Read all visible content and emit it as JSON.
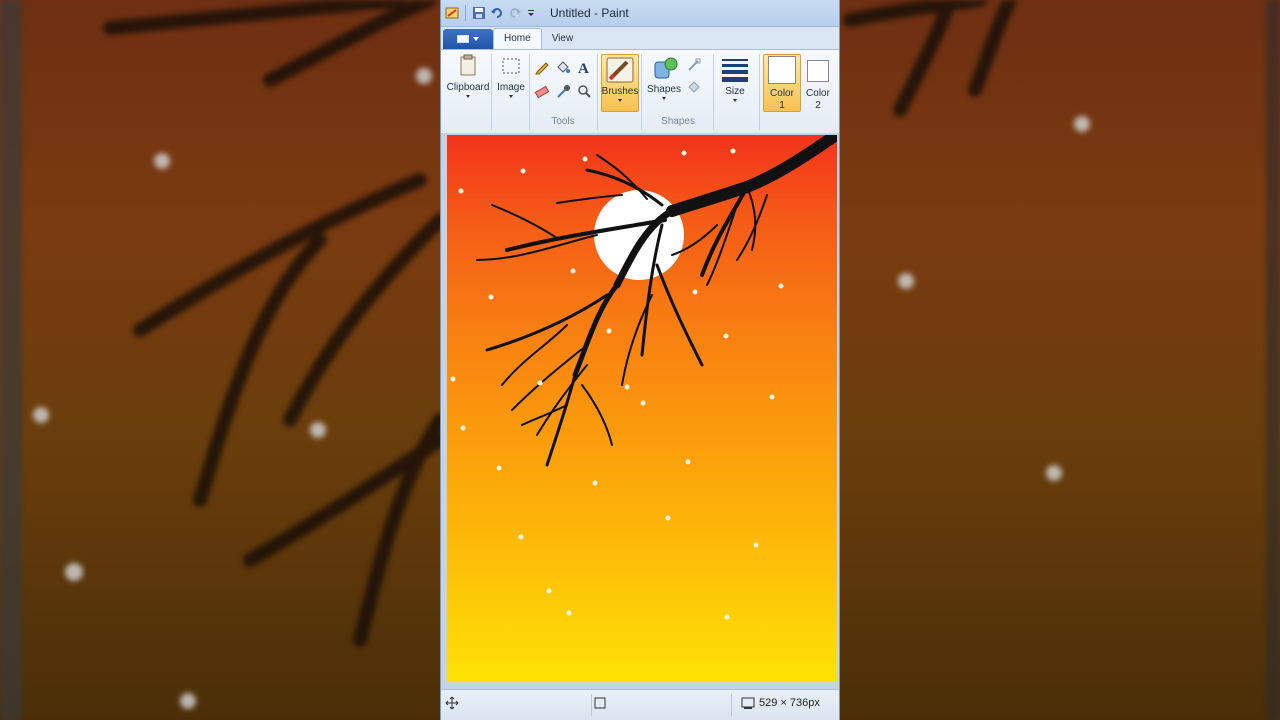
{
  "window": {
    "title": "Untitled - Paint"
  },
  "tabs": [
    "Home",
    "View"
  ],
  "ribbon": {
    "clipboard_label": "Clipboard",
    "image_label": "Image",
    "tools_group_label": "Tools",
    "brushes_label": "Brushes",
    "shapes_label": "Shapes",
    "shapes_group_label": "Shapes",
    "size_label": "Size",
    "color1_label": "Color",
    "color1_num": "1",
    "color2_label": "Color",
    "color2_num": "2"
  },
  "statusbar": {
    "canvas_size": "529 × 736px"
  },
  "colors": {
    "accent": "#1f55a8",
    "highlight": "#f7c24f",
    "sky_top": "#f2331b",
    "sky_bottom": "#fde205",
    "branch": "#111111",
    "moon": "#ffffff"
  }
}
